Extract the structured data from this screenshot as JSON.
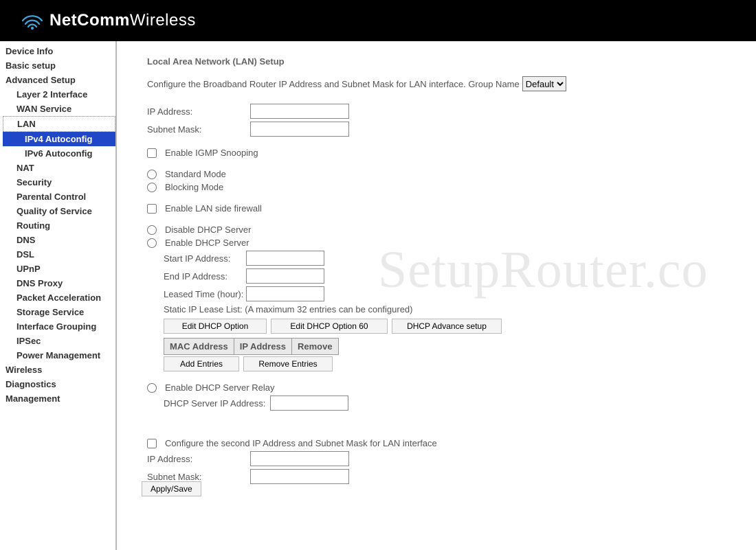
{
  "brand": {
    "bold": "NetComm",
    "thin": "Wireless"
  },
  "watermark": "SetupRouter.co",
  "nav": {
    "device_info": "Device Info",
    "basic_setup": "Basic setup",
    "advanced_setup": "Advanced Setup",
    "layer2": "Layer 2 Interface",
    "wan_service": "WAN Service",
    "lan": "LAN",
    "ipv4_autoconfig": "IPv4 Autoconfig",
    "ipv6_autoconfig": "IPv6 Autoconfig",
    "nat": "NAT",
    "security": "Security",
    "parental": "Parental Control",
    "qos": "Quality of Service",
    "routing": "Routing",
    "dns": "DNS",
    "dsl": "DSL",
    "upnp": "UPnP",
    "dns_proxy": "DNS Proxy",
    "packet_acc": "Packet Acceleration",
    "storage": "Storage Service",
    "iface_group": "Interface Grouping",
    "ipsec": "IPSec",
    "power_mgmt": "Power Management",
    "wireless": "Wireless",
    "diagnostics": "Diagnostics",
    "management": "Management"
  },
  "page": {
    "title": "Local Area Network (LAN) Setup",
    "description": "Configure the Broadband Router IP Address and Subnet Mask for LAN interface. Group Name",
    "group_name_value": "Default",
    "ip_address_label": "IP Address:",
    "subnet_mask_label": "Subnet Mask:",
    "enable_igmp": "Enable IGMP Snooping",
    "standard_mode": "Standard Mode",
    "blocking_mode": "Blocking Mode",
    "enable_lan_firewall": "Enable LAN side firewall",
    "disable_dhcp": "Disable DHCP Server",
    "enable_dhcp": "Enable DHCP Server",
    "start_ip": "Start IP Address:",
    "end_ip": "End IP Address:",
    "leased_time": "Leased Time (hour):",
    "static_lease_list": "Static IP Lease List: (A maximum 32 entries can be configured)",
    "btn_edit_dhcp_option": "Edit DHCP Option",
    "btn_edit_dhcp_option60": "Edit DHCP Option 60",
    "btn_dhcp_advance": "DHCP Advance setup",
    "th_mac": "MAC Address",
    "th_ip": "IP Address",
    "th_remove": "Remove",
    "btn_add_entries": "Add Entries",
    "btn_remove_entries": "Remove Entries",
    "enable_dhcp_relay": "Enable DHCP Server Relay",
    "dhcp_relay_ip": "DHCP Server IP Address:",
    "second_ip_desc": "Configure the second IP Address and Subnet Mask for LAN interface",
    "second_ip_label": "IP Address:",
    "second_subnet_label": "Subnet Mask:",
    "apply_save": "Apply/Save"
  }
}
